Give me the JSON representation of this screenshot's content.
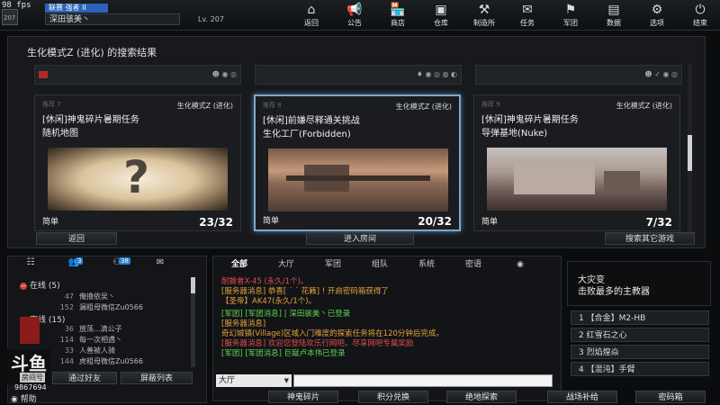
{
  "hud": {
    "fps": "98 fps",
    "rank_num": "207"
  },
  "player": {
    "title": "联赛 强者 II",
    "name": "深田骇美丶",
    "level": "Lv. 207"
  },
  "nav": [
    {
      "label": "返回",
      "icon": "home-icon",
      "glyph": "⌂"
    },
    {
      "label": "公告",
      "icon": "megaphone-icon",
      "glyph": "📢"
    },
    {
      "label": "商店",
      "icon": "shop-icon",
      "glyph": "🏪"
    },
    {
      "label": "仓库",
      "icon": "inventory-icon",
      "glyph": "▣"
    },
    {
      "label": "制造所",
      "icon": "workshop-icon",
      "glyph": "⚒"
    },
    {
      "label": "任务",
      "icon": "mission-icon",
      "glyph": "✉"
    },
    {
      "label": "军团",
      "icon": "clan-icon",
      "glyph": "⚑"
    },
    {
      "label": "数据",
      "icon": "stats-icon",
      "glyph": "▤"
    },
    {
      "label": "选项",
      "icon": "gear-icon",
      "glyph": "⚙"
    },
    {
      "label": "结束",
      "icon": "power-icon",
      "glyph": "⏻"
    }
  ],
  "main": {
    "title": "生化模式Z (进化) 的搜索结果",
    "rooms": [
      {
        "recommend": "推荐 7",
        "mode": "生化模式Z (进化)",
        "name1": "[休闲]神鬼碎片暑期任务",
        "name2": "随机地图",
        "difficulty": "简单",
        "count": "23/32"
      },
      {
        "recommend": "推荐 8",
        "mode": "生化模式Z (进化)",
        "name1": "[休闲]前嫌尽释通关挑战",
        "name2": "生化工厂(Forbidden)",
        "difficulty": "简单",
        "count": "20/32"
      },
      {
        "recommend": "推荐 9",
        "mode": "生化模式Z (进化)",
        "name1": "[休闲]神鬼碎片暑期任务",
        "name2": "导弹基地(Nuke)",
        "difficulty": "简单",
        "count": "7/32"
      }
    ],
    "back_label": "返回",
    "enter_label": "进入房间",
    "search_other_label": "搜索其它游戏"
  },
  "friends": {
    "tab_badges": [
      "3",
      "38"
    ],
    "online_label": "在线 (5)",
    "online": [
      {
        "lv": "47",
        "name": "俺撸依吴丶"
      },
      {
        "lv": "152",
        "name": "漏粗母微信Zu0566"
      }
    ],
    "offline_label": "离线 (15)",
    "offline": [
      {
        "lv": "36",
        "name": "放荡...滴公子"
      },
      {
        "lv": "114",
        "name": "每一次相遇丶"
      },
      {
        "lv": "33",
        "name": "人善被人骑"
      },
      {
        "lv": "144",
        "name": "虎粗母微信Zu0566"
      }
    ],
    "add_label": "通过好友",
    "block_label": "屏蔽列表",
    "logo": "斗鱼",
    "logo_sub": "房间号",
    "room_id": "9867694",
    "help_label": "帮助"
  },
  "chat": {
    "tabs": [
      "全部",
      "大厅",
      "军团",
      "组队",
      "系统",
      "密语"
    ],
    "lines": [
      {
        "cls": "c-red",
        "text": "耐撕者X-45 (永久/1个)。"
      },
      {
        "cls": "c-orange",
        "text": "[服务器消息] 恭喜[ ˙ ˙ 花籁] ! 开启密码箱获得了"
      },
      {
        "cls": "c-orange",
        "text": "【圣帝】AK47(永久/1个)。"
      },
      {
        "cls": "c-green",
        "text": "[军团] [军团消息] | 深田骇美丶已登录"
      },
      {
        "cls": "c-orange",
        "text": "[服务器消息]"
      },
      {
        "cls": "c-orange",
        "text": "奇幻城镇(Village)区域入门难度的探索任务将在120分钟后完成。"
      },
      {
        "cls": "c-red",
        "text": "[服务器消息] 欢迎您登陆欢乐行网吧，尽享网吧专属奖励"
      },
      {
        "cls": "c-green",
        "text": "[军团] [军团消息] 巨蹴卢本伟已登录"
      }
    ],
    "channel": "大厅"
  },
  "event": {
    "title": "大灾变",
    "subtitle": "击败最多的主教器",
    "ranks": [
      "1 【合金】M2-HB",
      "2 红雪石之心",
      "3 烈焰煌焱",
      "4 【混沌】手臂"
    ]
  },
  "bottom": [
    "神鬼碎片",
    "积分兑换",
    "绝地探索",
    "战场补给",
    "密码箱"
  ]
}
